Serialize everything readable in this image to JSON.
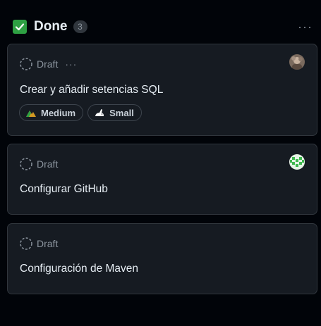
{
  "column": {
    "title": "Done",
    "count": "3",
    "menu_label": "···"
  },
  "cards": [
    {
      "status": "Draft",
      "more_label": "···",
      "title": "Crear y añadir setencias SQL",
      "labels": [
        {
          "text": "Medium",
          "icon": "mountain-icon"
        },
        {
          "text": "Small",
          "icon": "rabbit-icon"
        }
      ],
      "avatar": "user-avatar-photo"
    },
    {
      "status": "Draft",
      "title": "Configurar GitHub",
      "avatar": "user-avatar-identicon"
    },
    {
      "status": "Draft",
      "title": "Configuración de Maven"
    }
  ],
  "colors": {
    "done": "#2ea043",
    "card_bg": "#161b22",
    "border": "#30363d"
  }
}
